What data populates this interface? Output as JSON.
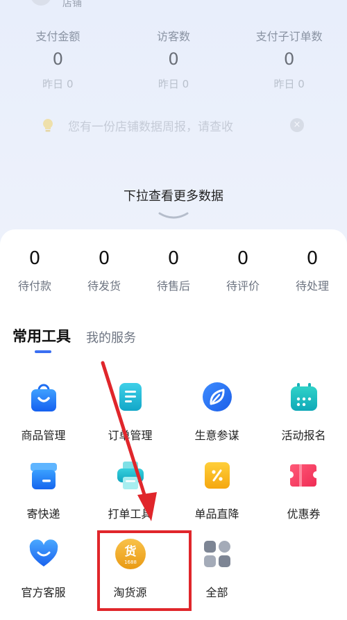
{
  "header": {
    "name": "店铺"
  },
  "stats": [
    {
      "label": "支付金额",
      "value": "0",
      "yesterday": "昨日 0"
    },
    {
      "label": "访客数",
      "value": "0",
      "yesterday": "昨日 0"
    },
    {
      "label": "支付子订单数",
      "value": "0",
      "yesterday": "昨日 0"
    }
  ],
  "notice": {
    "text": "您有一份店铺数据周报，请查收",
    "close": "×"
  },
  "pull_hint": "下拉查看更多数据",
  "orders": [
    {
      "value": "0",
      "label": "待付款"
    },
    {
      "value": "0",
      "label": "待发货"
    },
    {
      "value": "0",
      "label": "待售后"
    },
    {
      "value": "0",
      "label": "待评价"
    },
    {
      "value": "0",
      "label": "待处理"
    }
  ],
  "tabs": {
    "active": "常用工具",
    "other": "我的服务"
  },
  "tools": [
    {
      "label": "商品管理",
      "icon": "shopping-bag-icon"
    },
    {
      "label": "订单管理",
      "icon": "order-list-icon"
    },
    {
      "label": "生意参谋",
      "icon": "compass-leaf-icon"
    },
    {
      "label": "活动报名",
      "icon": "calendar-icon"
    },
    {
      "label": "寄快递",
      "icon": "package-box-icon"
    },
    {
      "label": "打单工具",
      "icon": "printer-icon"
    },
    {
      "label": "单品直降",
      "icon": "discount-tag-icon"
    },
    {
      "label": "优惠券",
      "icon": "coupon-ticket-icon"
    },
    {
      "label": "官方客服",
      "icon": "heart-service-icon"
    },
    {
      "label": "淘货源",
      "icon": "taohuoyuan-1688-icon",
      "badge": "货",
      "badge_sub": "1688"
    },
    {
      "label": "全部",
      "icon": "all-apps-grid-icon"
    }
  ],
  "colors": {
    "accent": "#3a6ff2",
    "highlight": "#e0262b"
  }
}
